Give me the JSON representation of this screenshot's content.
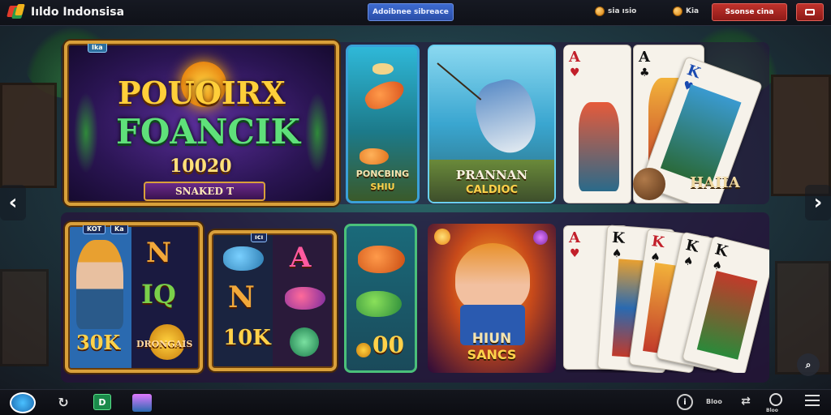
{
  "header": {
    "logo_text": "Iıldo Indonsisa",
    "center_button": "Adoibnee sibreace",
    "stat_1": "sia ısio",
    "stat_2": "Kia",
    "red_button": "Ssonse cina",
    "menu_icon": "flag-icon"
  },
  "featured": {
    "main_banner": {
      "badge": "Ika",
      "title_line1": "POUOIRX",
      "title_line2": "FOANCIK",
      "amount": "10020",
      "button_label": "SNAKED T"
    },
    "fishing_1": {
      "caption_line1": "PONCBING",
      "caption_line2": "SHIU"
    },
    "fishing_2": {
      "caption_line1": "PRANNAN",
      "caption_line2": "CALDIOC"
    },
    "cards": {
      "caption": "HAIIA",
      "rank_1": "A",
      "rank_2": "A",
      "rank_3": "K"
    }
  },
  "row2": {
    "slot_1": {
      "badge_1": "KOT",
      "badge_2": "Ka",
      "sym_1": "N",
      "sym_2": "IQ",
      "amount": "30K",
      "label": "DRONGAIS"
    },
    "slot_2": {
      "badge": "ıcı",
      "sym_1": "A",
      "sym_2": "N",
      "amount": "10K"
    },
    "slot_3": {
      "amount": "00"
    },
    "hero": {
      "caption_line1": "HIUN",
      "caption_line2": "SANCS"
    },
    "cards2": {
      "rank_1": "A",
      "rank_2": "K",
      "rank_3": "K",
      "rank_4": "K",
      "rank_5": "K"
    }
  },
  "nav": {
    "prev_arrow": "‹",
    "next_arrow": "›"
  },
  "bottom": {
    "item_label": "Bloo",
    "settings_label": "Bloo"
  },
  "colors": {
    "accent_gold": "#d9a03a",
    "header_bg": "#0f1118",
    "primary_blue": "#2a4ea8",
    "danger_red": "#8e1a17"
  }
}
